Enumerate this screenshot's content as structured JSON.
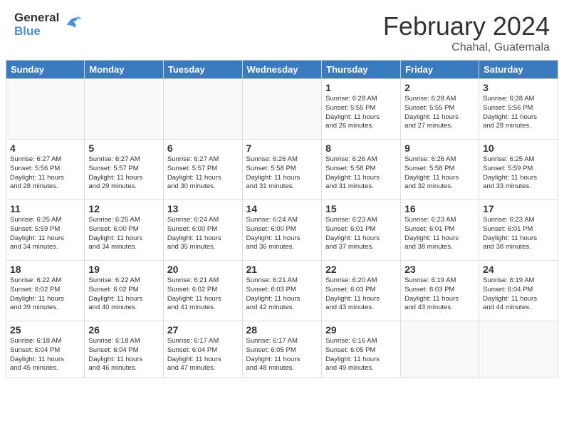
{
  "header": {
    "logo_general": "General",
    "logo_blue": "Blue",
    "month_year": "February 2024",
    "location": "Chahal, Guatemala"
  },
  "weekdays": [
    "Sunday",
    "Monday",
    "Tuesday",
    "Wednesday",
    "Thursday",
    "Friday",
    "Saturday"
  ],
  "weeks": [
    [
      {
        "day": "",
        "detail": ""
      },
      {
        "day": "",
        "detail": ""
      },
      {
        "day": "",
        "detail": ""
      },
      {
        "day": "",
        "detail": ""
      },
      {
        "day": "1",
        "detail": "Sunrise: 6:28 AM\nSunset: 5:55 PM\nDaylight: 11 hours\nand 26 minutes."
      },
      {
        "day": "2",
        "detail": "Sunrise: 6:28 AM\nSunset: 5:55 PM\nDaylight: 11 hours\nand 27 minutes."
      },
      {
        "day": "3",
        "detail": "Sunrise: 6:28 AM\nSunset: 5:56 PM\nDaylight: 11 hours\nand 28 minutes."
      }
    ],
    [
      {
        "day": "4",
        "detail": "Sunrise: 6:27 AM\nSunset: 5:56 PM\nDaylight: 11 hours\nand 28 minutes."
      },
      {
        "day": "5",
        "detail": "Sunrise: 6:27 AM\nSunset: 5:57 PM\nDaylight: 11 hours\nand 29 minutes."
      },
      {
        "day": "6",
        "detail": "Sunrise: 6:27 AM\nSunset: 5:57 PM\nDaylight: 11 hours\nand 30 minutes."
      },
      {
        "day": "7",
        "detail": "Sunrise: 6:26 AM\nSunset: 5:58 PM\nDaylight: 11 hours\nand 31 minutes."
      },
      {
        "day": "8",
        "detail": "Sunrise: 6:26 AM\nSunset: 5:58 PM\nDaylight: 11 hours\nand 31 minutes."
      },
      {
        "day": "9",
        "detail": "Sunrise: 6:26 AM\nSunset: 5:58 PM\nDaylight: 11 hours\nand 32 minutes."
      },
      {
        "day": "10",
        "detail": "Sunrise: 6:25 AM\nSunset: 5:59 PM\nDaylight: 11 hours\nand 33 minutes."
      }
    ],
    [
      {
        "day": "11",
        "detail": "Sunrise: 6:25 AM\nSunset: 5:59 PM\nDaylight: 11 hours\nand 34 minutes."
      },
      {
        "day": "12",
        "detail": "Sunrise: 6:25 AM\nSunset: 6:00 PM\nDaylight: 11 hours\nand 34 minutes."
      },
      {
        "day": "13",
        "detail": "Sunrise: 6:24 AM\nSunset: 6:00 PM\nDaylight: 11 hours\nand 35 minutes."
      },
      {
        "day": "14",
        "detail": "Sunrise: 6:24 AM\nSunset: 6:00 PM\nDaylight: 11 hours\nand 36 minutes."
      },
      {
        "day": "15",
        "detail": "Sunrise: 6:23 AM\nSunset: 6:01 PM\nDaylight: 11 hours\nand 37 minutes."
      },
      {
        "day": "16",
        "detail": "Sunrise: 6:23 AM\nSunset: 6:01 PM\nDaylight: 11 hours\nand 38 minutes."
      },
      {
        "day": "17",
        "detail": "Sunrise: 6:23 AM\nSunset: 6:01 PM\nDaylight: 11 hours\nand 38 minutes."
      }
    ],
    [
      {
        "day": "18",
        "detail": "Sunrise: 6:22 AM\nSunset: 6:02 PM\nDaylight: 11 hours\nand 39 minutes."
      },
      {
        "day": "19",
        "detail": "Sunrise: 6:22 AM\nSunset: 6:02 PM\nDaylight: 11 hours\nand 40 minutes."
      },
      {
        "day": "20",
        "detail": "Sunrise: 6:21 AM\nSunset: 6:02 PM\nDaylight: 11 hours\nand 41 minutes."
      },
      {
        "day": "21",
        "detail": "Sunrise: 6:21 AM\nSunset: 6:03 PM\nDaylight: 11 hours\nand 42 minutes."
      },
      {
        "day": "22",
        "detail": "Sunrise: 6:20 AM\nSunset: 6:03 PM\nDaylight: 11 hours\nand 43 minutes."
      },
      {
        "day": "23",
        "detail": "Sunrise: 6:19 AM\nSunset: 6:03 PM\nDaylight: 11 hours\nand 43 minutes."
      },
      {
        "day": "24",
        "detail": "Sunrise: 6:19 AM\nSunset: 6:04 PM\nDaylight: 11 hours\nand 44 minutes."
      }
    ],
    [
      {
        "day": "25",
        "detail": "Sunrise: 6:18 AM\nSunset: 6:04 PM\nDaylight: 11 hours\nand 45 minutes."
      },
      {
        "day": "26",
        "detail": "Sunrise: 6:18 AM\nSunset: 6:04 PM\nDaylight: 11 hours\nand 46 minutes."
      },
      {
        "day": "27",
        "detail": "Sunrise: 6:17 AM\nSunset: 6:04 PM\nDaylight: 11 hours\nand 47 minutes."
      },
      {
        "day": "28",
        "detail": "Sunrise: 6:17 AM\nSunset: 6:05 PM\nDaylight: 11 hours\nand 48 minutes."
      },
      {
        "day": "29",
        "detail": "Sunrise: 6:16 AM\nSunset: 6:05 PM\nDaylight: 11 hours\nand 49 minutes."
      },
      {
        "day": "",
        "detail": ""
      },
      {
        "day": "",
        "detail": ""
      }
    ]
  ]
}
